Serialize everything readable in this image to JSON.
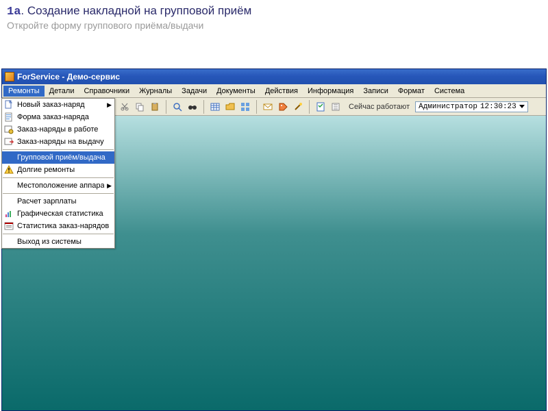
{
  "slide": {
    "step_num": "1a",
    "step_title": "Создание накладной на групповой приём",
    "subtitle": "Откройте форму группового приёма/выдачи"
  },
  "window": {
    "title": "ForService - Демо-сервис"
  },
  "menubar": {
    "items": [
      {
        "label": "Ремонты",
        "active": true
      },
      {
        "label": "Детали"
      },
      {
        "label": "Справочники"
      },
      {
        "label": "Журналы"
      },
      {
        "label": "Задачи"
      },
      {
        "label": "Документы"
      },
      {
        "label": "Действия"
      },
      {
        "label": "Информация"
      },
      {
        "label": "Записи"
      },
      {
        "label": "Формат"
      },
      {
        "label": "Система"
      }
    ]
  },
  "dropdown": {
    "items": [
      {
        "label": "Новый заказ-наряд",
        "icon": "new-doc",
        "submenu": true
      },
      {
        "label": "Форма заказ-наряда",
        "icon": "form-doc"
      },
      {
        "label": "Заказ-наряды в работе",
        "icon": "orders-work"
      },
      {
        "label": "Заказ-наряды на выдачу",
        "icon": "orders-out"
      },
      {
        "sep": true
      },
      {
        "label": "Групповой приём/выдача",
        "icon": "none",
        "selected": true
      },
      {
        "label": "Долгие ремонты",
        "icon": "warning"
      },
      {
        "sep": true
      },
      {
        "label": "Местоположение аппаратов",
        "icon": "none",
        "submenu": true
      },
      {
        "sep": true
      },
      {
        "label": "Расчет зарплаты",
        "icon": "none"
      },
      {
        "label": "Графическая статистика",
        "icon": "chart"
      },
      {
        "label": "Статистика заказ-нарядов",
        "icon": "stats"
      },
      {
        "sep": true
      },
      {
        "label": "Выход из системы",
        "icon": "none"
      }
    ]
  },
  "toolbar": {
    "buttons": [
      "scissors-icon",
      "copy-icon",
      "paste-icon",
      "sep",
      "find-icon",
      "binoculars-icon",
      "sep",
      "table-icon",
      "folder-icon",
      "views-icon",
      "sep",
      "mail-icon",
      "tag-icon",
      "wand-icon",
      "sep",
      "task-icon",
      "list-icon"
    ],
    "status_label": "Сейчас работают",
    "status_user": "Администратор",
    "status_time": "12:30:23"
  }
}
